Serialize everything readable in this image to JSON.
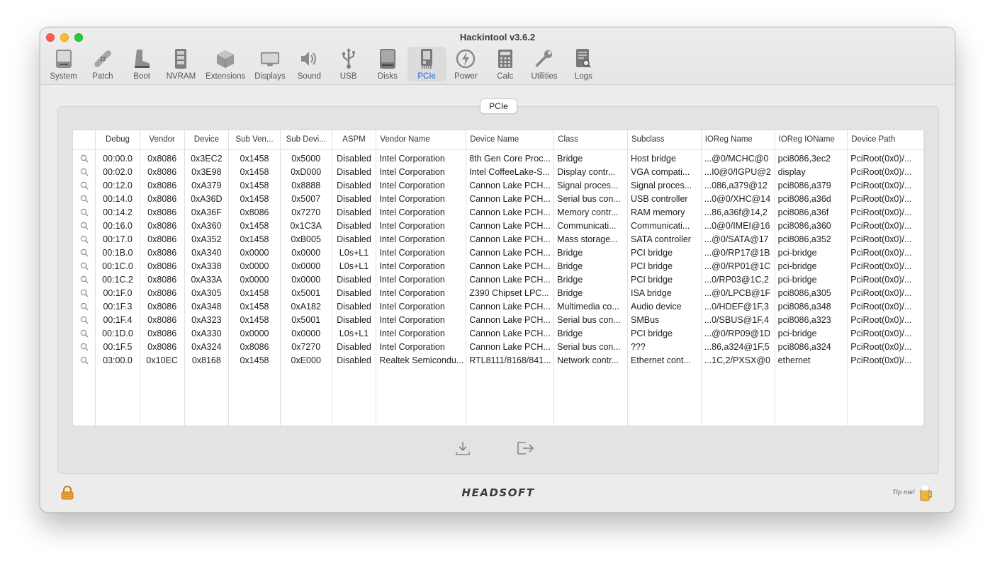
{
  "window": {
    "title": "Hackintool v3.6.2"
  },
  "toolbar": {
    "items": [
      {
        "label": "System",
        "icon": "system-icon"
      },
      {
        "label": "Patch",
        "icon": "patch-icon"
      },
      {
        "label": "Boot",
        "icon": "boot-icon"
      },
      {
        "label": "NVRAM",
        "icon": "nvram-icon"
      },
      {
        "label": "Extensions",
        "icon": "extensions-icon"
      },
      {
        "label": "Displays",
        "icon": "displays-icon"
      },
      {
        "label": "Sound",
        "icon": "sound-icon"
      },
      {
        "label": "USB",
        "icon": "usb-icon"
      },
      {
        "label": "Disks",
        "icon": "disks-icon"
      },
      {
        "label": "PCIe",
        "icon": "pcie-icon",
        "active": true
      },
      {
        "label": "Power",
        "icon": "power-icon"
      },
      {
        "label": "Calc",
        "icon": "calc-icon"
      },
      {
        "label": "Utilities",
        "icon": "utilities-icon"
      },
      {
        "label": "Logs",
        "icon": "logs-icon"
      }
    ]
  },
  "group": {
    "title": "PCIe"
  },
  "table": {
    "columns": [
      "",
      "Debug",
      "Vendor",
      "Device",
      "Sub Ven...",
      "Sub Devi...",
      "ASPM",
      "Vendor Name",
      "Device Name",
      "Class",
      "Subclass",
      "IOReg Name",
      "IOReg IOName",
      "Device Path"
    ],
    "rows": [
      [
        "00:00.0",
        "0x8086",
        "0x3EC2",
        "0x1458",
        "0x5000",
        "Disabled",
        "Intel Corporation",
        "8th Gen Core Proc...",
        "Bridge",
        "Host bridge",
        "...@0/MCHC@0",
        "pci8086,3ec2",
        "PciRoot(0x0)/..."
      ],
      [
        "00:02.0",
        "0x8086",
        "0x3E98",
        "0x1458",
        "0xD000",
        "Disabled",
        "Intel Corporation",
        "Intel CoffeeLake-S...",
        "Display contr...",
        "VGA compati...",
        "...I0@0/IGPU@2",
        "display",
        "PciRoot(0x0)/..."
      ],
      [
        "00:12.0",
        "0x8086",
        "0xA379",
        "0x1458",
        "0x8888",
        "Disabled",
        "Intel Corporation",
        "Cannon Lake PCH...",
        "Signal proces...",
        "Signal proces...",
        "...086,a379@12",
        "pci8086,a379",
        "PciRoot(0x0)/..."
      ],
      [
        "00:14.0",
        "0x8086",
        "0xA36D",
        "0x1458",
        "0x5007",
        "Disabled",
        "Intel Corporation",
        "Cannon Lake PCH...",
        "Serial bus con...",
        "USB controller",
        "...0@0/XHC@14",
        "pci8086,a36d",
        "PciRoot(0x0)/..."
      ],
      [
        "00:14.2",
        "0x8086",
        "0xA36F",
        "0x8086",
        "0x7270",
        "Disabled",
        "Intel Corporation",
        "Cannon Lake PCH...",
        "Memory contr...",
        "RAM memory",
        "...86,a36f@14,2",
        "pci8086,a36f",
        "PciRoot(0x0)/..."
      ],
      [
        "00:16.0",
        "0x8086",
        "0xA360",
        "0x1458",
        "0x1C3A",
        "Disabled",
        "Intel Corporation",
        "Cannon Lake PCH...",
        "Communicati...",
        "Communicati...",
        "...0@0/IMEI@16",
        "pci8086,a360",
        "PciRoot(0x0)/..."
      ],
      [
        "00:17.0",
        "0x8086",
        "0xA352",
        "0x1458",
        "0xB005",
        "Disabled",
        "Intel Corporation",
        "Cannon Lake PCH...",
        "Mass storage...",
        "SATA controller",
        "...@0/SATA@17",
        "pci8086,a352",
        "PciRoot(0x0)/..."
      ],
      [
        "00:1B.0",
        "0x8086",
        "0xA340",
        "0x0000",
        "0x0000",
        "L0s+L1",
        "Intel Corporation",
        "Cannon Lake PCH...",
        "Bridge",
        "PCI bridge",
        "...@0/RP17@1B",
        "pci-bridge",
        "PciRoot(0x0)/..."
      ],
      [
        "00:1C.0",
        "0x8086",
        "0xA338",
        "0x0000",
        "0x0000",
        "L0s+L1",
        "Intel Corporation",
        "Cannon Lake PCH...",
        "Bridge",
        "PCI bridge",
        "...@0/RP01@1C",
        "pci-bridge",
        "PciRoot(0x0)/..."
      ],
      [
        "00:1C.2",
        "0x8086",
        "0xA33A",
        "0x0000",
        "0x0000",
        "Disabled",
        "Intel Corporation",
        "Cannon Lake PCH...",
        "Bridge",
        "PCI bridge",
        "...0/RP03@1C,2",
        "pci-bridge",
        "PciRoot(0x0)/..."
      ],
      [
        "00:1F.0",
        "0x8086",
        "0xA305",
        "0x1458",
        "0x5001",
        "Disabled",
        "Intel Corporation",
        "Z390 Chipset LPC...",
        "Bridge",
        "ISA bridge",
        "...@0/LPCB@1F",
        "pci8086,a305",
        "PciRoot(0x0)/..."
      ],
      [
        "00:1F.3",
        "0x8086",
        "0xA348",
        "0x1458",
        "0xA182",
        "Disabled",
        "Intel Corporation",
        "Cannon Lake PCH...",
        "Multimedia co...",
        "Audio device",
        "...0/HDEF@1F,3",
        "pci8086,a348",
        "PciRoot(0x0)/..."
      ],
      [
        "00:1F.4",
        "0x8086",
        "0xA323",
        "0x1458",
        "0x5001",
        "Disabled",
        "Intel Corporation",
        "Cannon Lake PCH...",
        "Serial bus con...",
        "SMBus",
        "...0/SBUS@1F,4",
        "pci8086,a323",
        "PciRoot(0x0)/..."
      ],
      [
        "00:1D.0",
        "0x8086",
        "0xA330",
        "0x0000",
        "0x0000",
        "L0s+L1",
        "Intel Corporation",
        "Cannon Lake PCH...",
        "Bridge",
        "PCI bridge",
        "...@0/RP09@1D",
        "pci-bridge",
        "PciRoot(0x0)/..."
      ],
      [
        "00:1F.5",
        "0x8086",
        "0xA324",
        "0x8086",
        "0x7270",
        "Disabled",
        "Intel Corporation",
        "Cannon Lake PCH...",
        "Serial bus con...",
        "???",
        "...86,a324@1F,5",
        "pci8086,a324",
        "PciRoot(0x0)/..."
      ],
      [
        "03:00.0",
        "0x10EC",
        "0x8168",
        "0x1458",
        "0xE000",
        "Disabled",
        "Realtek Semicondu...",
        "RTL8111/8168/841...",
        "Network contr...",
        "Ethernet cont...",
        "...1C,2/PXSX@0",
        "ethernet",
        "PciRoot(0x0)/..."
      ]
    ]
  },
  "actions": {
    "export_icon": "download-icon",
    "quit_icon": "exit-icon"
  },
  "footer": {
    "brand": "HEADSOFT",
    "tip_label": "Tip me!",
    "lock_icon": "lock-icon",
    "beer_icon": "beer-icon"
  }
}
